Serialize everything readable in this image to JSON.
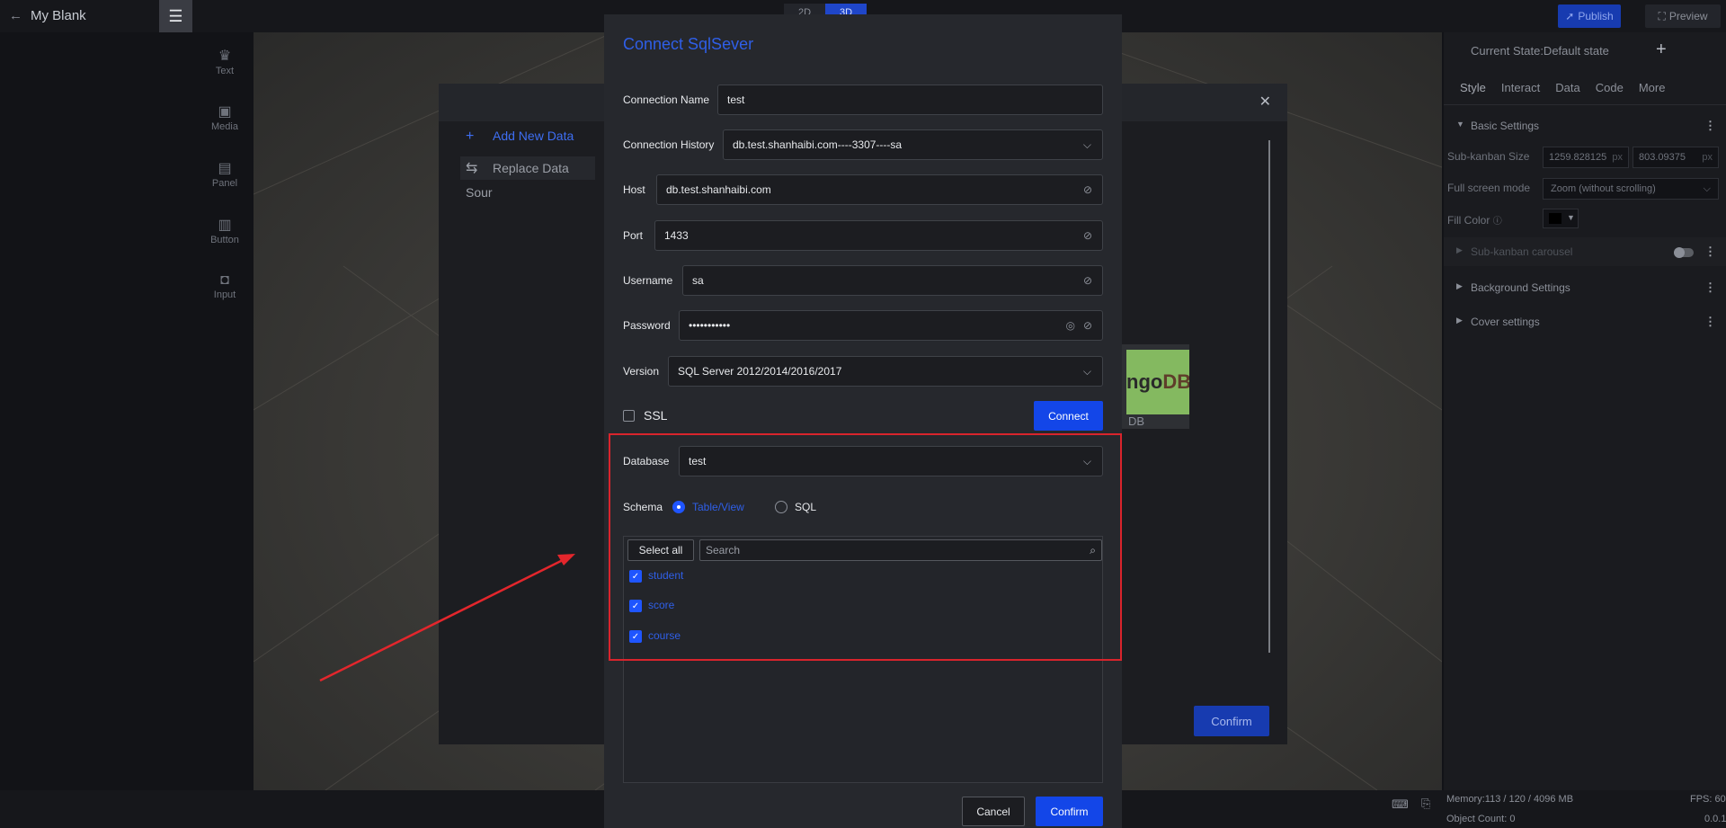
{
  "header": {
    "title": "My Blank",
    "modes": [
      "2D",
      "3D"
    ],
    "publish_label": "Publish",
    "preview_label": "Preview"
  },
  "tools": [
    "Text",
    "Media",
    "Panel",
    "Button",
    "Input"
  ],
  "data_source_dialog": {
    "add_new_label": "Add New Data",
    "replace_label": "Replace Data Sour",
    "tile_brand_a": "ngo",
    "tile_brand_b": "DB",
    "tile_label": "DB",
    "confirm_label": "Confirm"
  },
  "right_panel": {
    "state_label": "Current State:Default state",
    "tabs": [
      "Style",
      "Interact",
      "Data",
      "Code",
      "More"
    ],
    "basic_settings": "Basic Settings",
    "size_label": "Sub-kanban Size",
    "width_value": "1259.828125",
    "height_value": "803.09375",
    "unit": "px",
    "fullscreen_label": "Full screen mode",
    "fullscreen_value": "Zoom (without scrolling)",
    "fill_label": "Fill Color",
    "carousel_label": "Sub-kanban carousel",
    "background_label": "Background Settings",
    "cover_label": "Cover settings"
  },
  "status_bar": {
    "memory": "Memory:113 / 120 / 4096 MB",
    "fps": "FPS: 60",
    "object_count": "Object Count: 0",
    "version": "0.0.1"
  },
  "modal": {
    "title": "Connect SqlSever",
    "connection_name_label": "Connection Name",
    "connection_name_value": "test",
    "history_label": "Connection History",
    "history_value": "db.test.shanhaibi.com----3307----sa",
    "host_label": "Host",
    "host_value": "db.test.shanhaibi.com",
    "port_label": "Port",
    "port_value": "1433",
    "username_label": "Username",
    "username_value": "sa",
    "password_label": "Password",
    "password_value": "•••••••••••",
    "version_label": "Version",
    "version_value": "SQL Server 2012/2014/2016/2017",
    "ssl_label": "SSL",
    "connect_label": "Connect",
    "database_label": "Database",
    "database_value": "test",
    "schema_label": "Schema",
    "schema_options": [
      "Table/View",
      "SQL"
    ],
    "select_all_label": "Select all",
    "search_placeholder": "Search",
    "tables": [
      "student",
      "score",
      "course"
    ],
    "cancel_label": "Cancel",
    "confirm_label": "Confirm"
  },
  "colors": {
    "accent": "#1346e8",
    "highlight_border": "#d9242c",
    "arrow": "#e3262c"
  }
}
